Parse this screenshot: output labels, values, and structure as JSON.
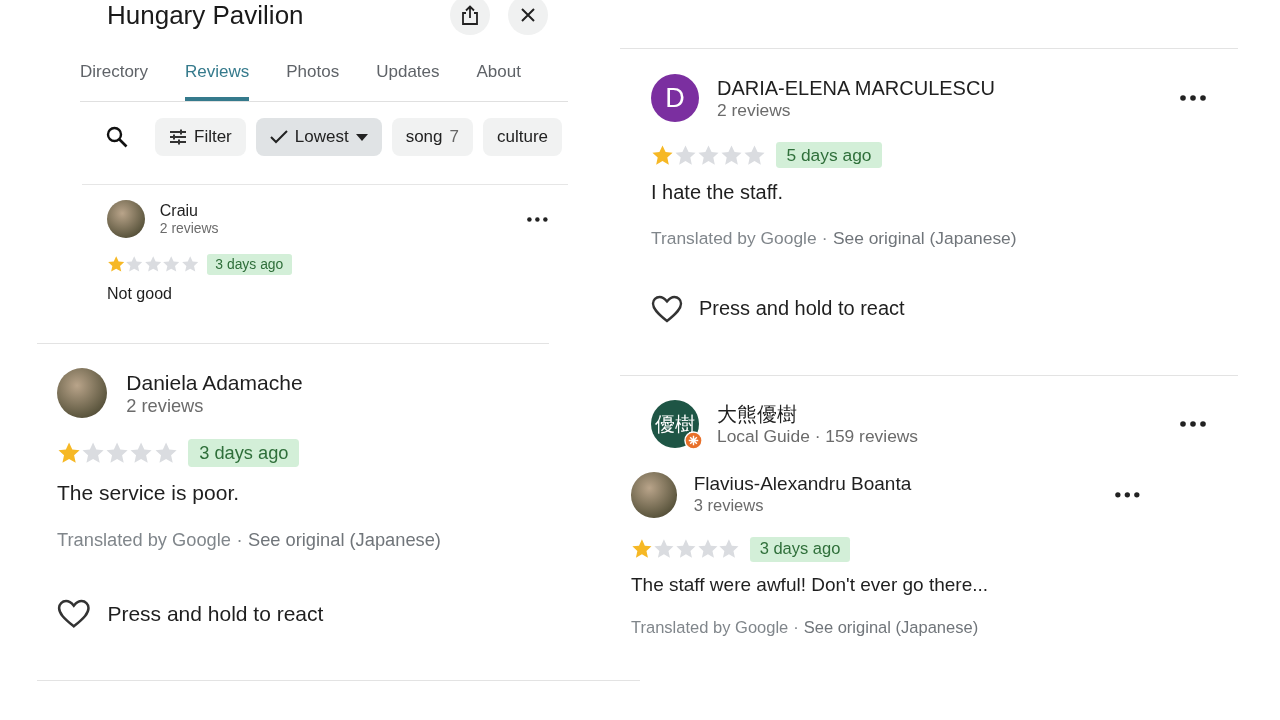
{
  "place": {
    "title": "Hungary Pavilion",
    "tabs": [
      {
        "label": "Directory",
        "selected": false
      },
      {
        "label": "Reviews",
        "selected": true
      },
      {
        "label": "Photos",
        "selected": false
      },
      {
        "label": "Updates",
        "selected": false
      },
      {
        "label": "About",
        "selected": false
      }
    ],
    "chips": [
      {
        "kind": "filter",
        "label": "Filter",
        "selected": false
      },
      {
        "kind": "sort",
        "label": "Lowest",
        "selected": true
      },
      {
        "kind": "topic",
        "label": "song",
        "count": "7",
        "selected": false
      },
      {
        "kind": "topic",
        "label": "culture",
        "selected": false
      }
    ]
  },
  "reviews": [
    {
      "name": "Craiu",
      "meta": "2 reviews",
      "avatar": {
        "kind": "photo",
        "badge": false
      },
      "menu": true,
      "stars": 1,
      "time": "3 days ago",
      "text": "Not good"
    },
    {
      "name": "Daniela Adamache",
      "meta": "2 reviews",
      "avatar": {
        "kind": "photo",
        "badge": false
      },
      "menu": false,
      "stars": 1,
      "time": "3 days ago",
      "text": "The service is poor.",
      "translation": {
        "by": "Translated by Google",
        "separator": "·",
        "link": "See original (Japanese)"
      },
      "react": "Press and hold to react"
    },
    {
      "name": "DARIA-ELENA MARCULESCU",
      "meta": "2 reviews",
      "avatar": {
        "kind": "letter",
        "text": "D",
        "color": "#7b2fa0",
        "badge": false
      },
      "menu": true,
      "stars": 1,
      "time": "5 days ago",
      "text": "I hate the staff.",
      "translation": {
        "by": "Translated by Google",
        "separator": "·",
        "link": "See original (Japanese)"
      },
      "react": "Press and hold to react"
    },
    {
      "name": "大熊優樹",
      "meta": "Local Guide · 159 reviews",
      "avatar": {
        "kind": "letter",
        "text": "優樹",
        "color": "#1e5545",
        "badge": true
      },
      "menu": true
    },
    {
      "name": "Flavius-Alexandru Boanta",
      "meta": "3 reviews",
      "avatar": {
        "kind": "photo",
        "badge": false
      },
      "menu": true,
      "stars": 1,
      "time": "3 days ago",
      "text": "The staff were awful! Don't ever go there...",
      "translation": {
        "by": "Translated by Google",
        "separator": "·",
        "link": "See original (Japanese)"
      }
    }
  ]
}
